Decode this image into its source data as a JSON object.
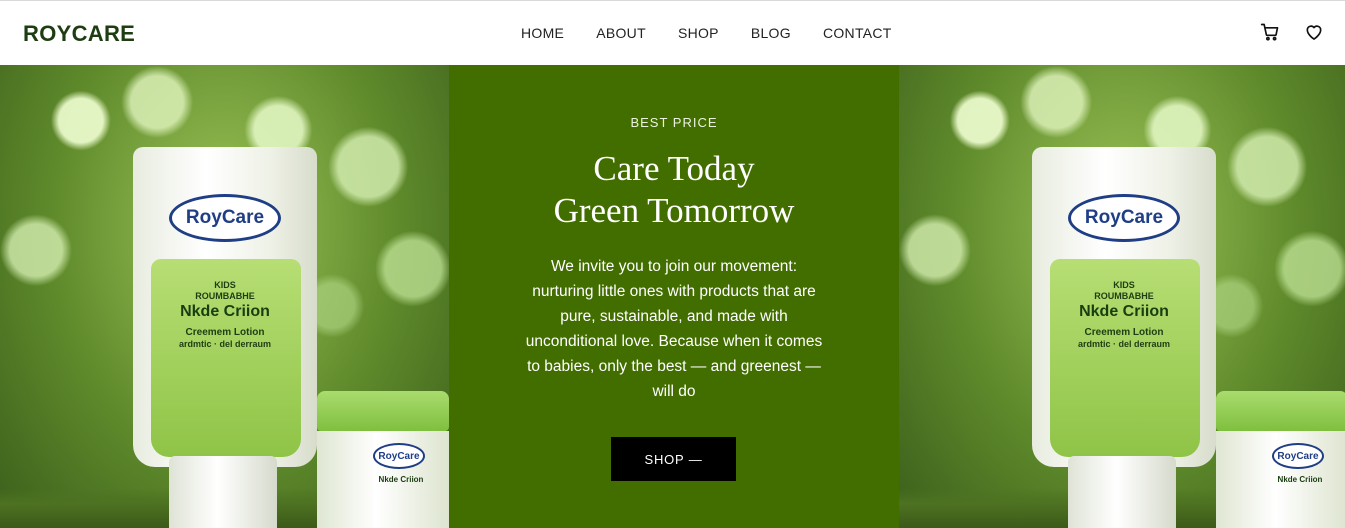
{
  "header": {
    "brand": "ROYCARE",
    "nav": [
      {
        "label": "HOME"
      },
      {
        "label": "ABOUT"
      },
      {
        "label": "SHOP"
      },
      {
        "label": "BLOG"
      },
      {
        "label": "CONTACT"
      }
    ],
    "icons": [
      "cart-icon",
      "heart-icon"
    ]
  },
  "hero": {
    "eyebrow": "BEST PRICE",
    "headline_line1": "Care Today",
    "headline_line2": "Green Tomorrow",
    "body": "We invite you to join our movement: nurturing little ones with products that are pure, sustainable, and made with unconditional love. Because when it comes to babies, only the best — and greenest — will do",
    "cta_label": "SHOP —",
    "panel_color": "#426e00",
    "cta_color": "#000000"
  },
  "product_image": {
    "tube_brand": "RoyCare",
    "tube_line1": "KIDS",
    "tube_line2": "ROUMBABHE",
    "tube_name": "Nkde Criion",
    "tube_desc1": "Creemem Lotion",
    "tube_desc2": "ardmtic · del derraum",
    "jar_brand": "RoyCare",
    "jar_name": "Nkde Criion"
  }
}
